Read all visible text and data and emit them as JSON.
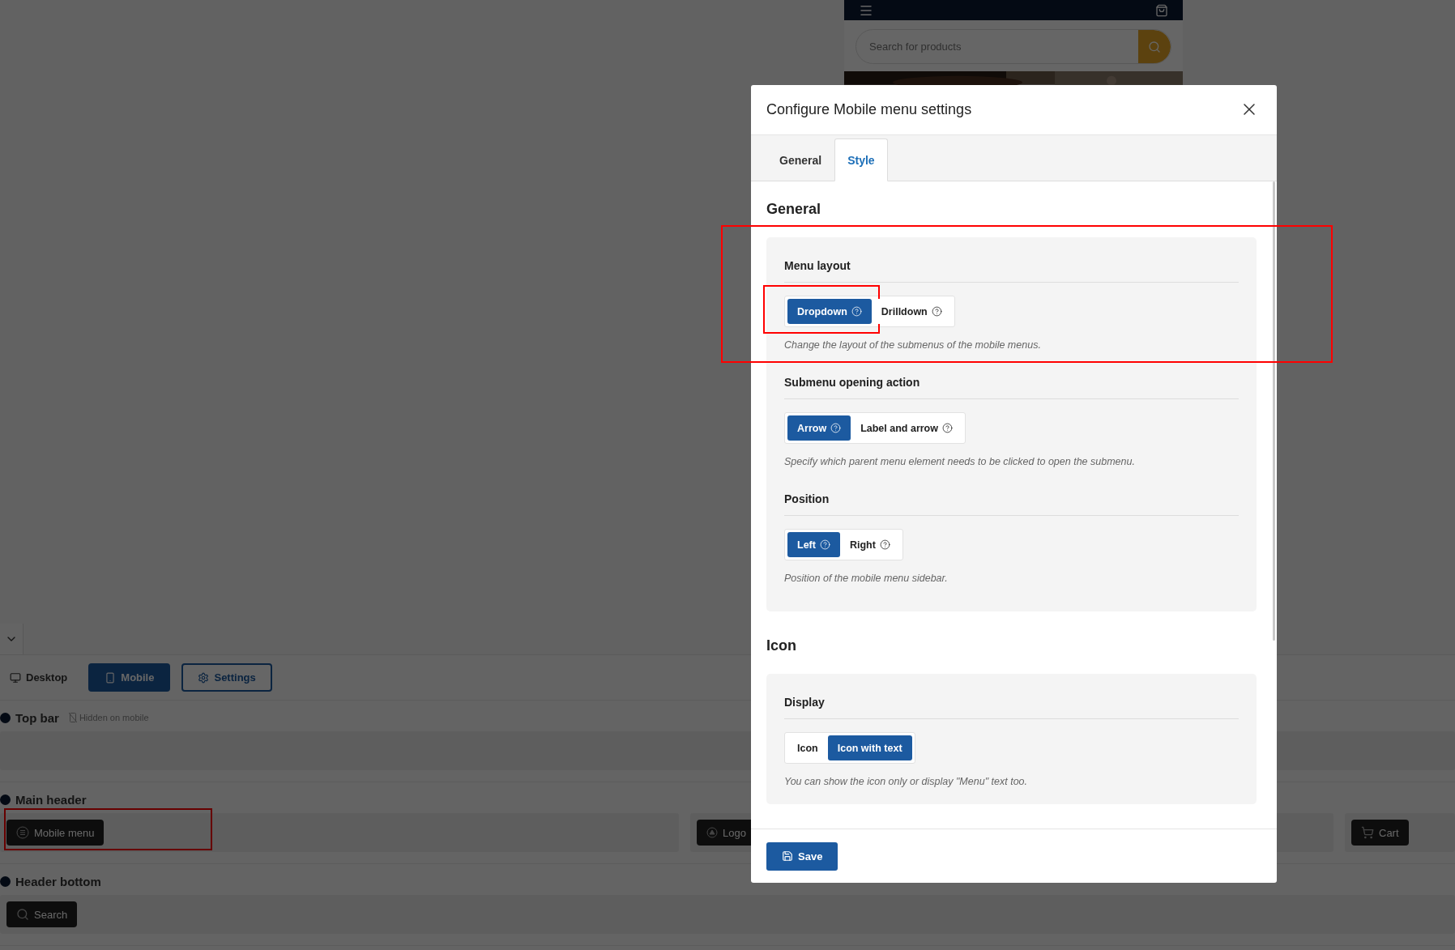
{
  "background": {
    "storefront": {
      "search_placeholder": "Search for products"
    },
    "builder": {
      "devices": [
        {
          "label": "Desktop",
          "kind": "desktop",
          "selected": false
        },
        {
          "label": "Mobile",
          "kind": "mobile",
          "selected": true
        }
      ],
      "settings_label": "Settings",
      "rows": [
        {
          "title": "Top bar",
          "note": "Hidden on mobile"
        },
        {
          "title": "Main header",
          "left": [
            {
              "label": "Mobile menu",
              "kind": "menu",
              "highlighted": true
            }
          ],
          "center": [
            {
              "label": "Logo",
              "kind": "logo"
            }
          ],
          "right": [
            {
              "label": "Cart",
              "kind": "cart"
            }
          ]
        },
        {
          "title": "Header bottom",
          "left": [
            {
              "label": "Search",
              "kind": "search"
            }
          ]
        }
      ]
    }
  },
  "modal": {
    "title": "Configure Mobile menu settings",
    "tabs": [
      {
        "label": "General",
        "selected": false
      },
      {
        "label": "Style",
        "selected": true
      }
    ],
    "sections": [
      {
        "heading": "General",
        "fields": [
          {
            "label": "Menu layout",
            "highlighted": true,
            "options": [
              {
                "label": "Dropdown",
                "help": true,
                "selected": true,
                "highlighted": true
              },
              {
                "label": "Drilldown",
                "help": true,
                "selected": false
              }
            ],
            "description": "Change the layout of the submenus of the mobile menus."
          },
          {
            "label": "Submenu opening action",
            "options": [
              {
                "label": "Arrow",
                "help": true,
                "selected": true
              },
              {
                "label": "Label and arrow",
                "help": true,
                "selected": false
              }
            ],
            "description": "Specify which parent menu element needs to be clicked to open the submenu."
          },
          {
            "label": "Position",
            "options": [
              {
                "label": "Left",
                "help": true,
                "selected": true
              },
              {
                "label": "Right",
                "help": true,
                "selected": false
              }
            ],
            "description": "Position of the mobile menu sidebar."
          }
        ]
      },
      {
        "heading": "Icon",
        "fields": [
          {
            "label": "Display",
            "options": [
              {
                "label": "Icon",
                "selected": false
              },
              {
                "label": "Icon with text",
                "selected": true
              }
            ],
            "description": "You can show the icon only or display \"Menu\" text too."
          }
        ]
      }
    ],
    "save_label": "Save"
  }
}
